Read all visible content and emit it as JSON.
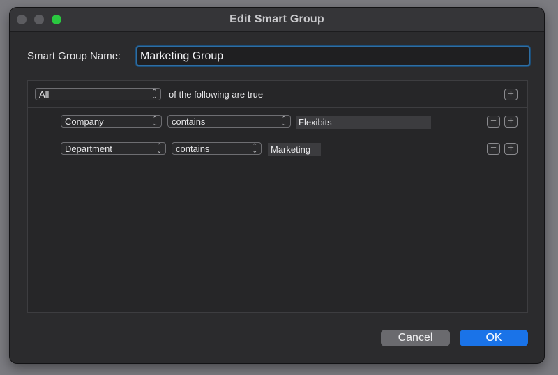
{
  "window": {
    "title": "Edit Smart Group"
  },
  "name_row": {
    "label": "Smart Group Name:",
    "value": "Marketing Group"
  },
  "criteria": {
    "match": {
      "selected": "All",
      "suffix": "of the following are true"
    },
    "rules": [
      {
        "field": "Company",
        "operator": "contains",
        "value": "Flexibits"
      },
      {
        "field": "Department",
        "operator": "contains",
        "value": "Marketing"
      }
    ]
  },
  "buttons": {
    "cancel": "Cancel",
    "ok": "OK"
  },
  "colors": {
    "accent": "#1a73e8",
    "focus_ring": "#2f6ea3",
    "zoom_light": "#2ac840"
  }
}
